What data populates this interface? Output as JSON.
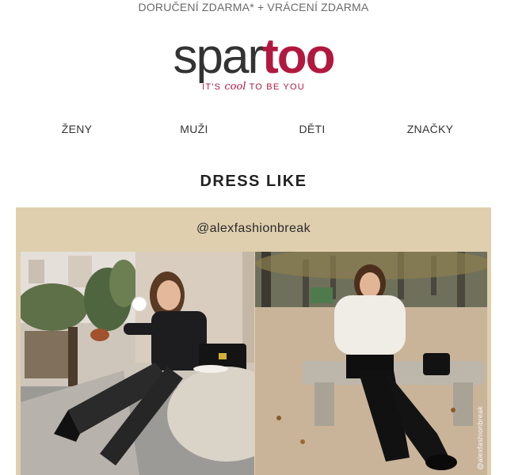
{
  "topbar": {
    "text": "DORUČENÍ ZDARMA* + VRÁCENÍ ZDARMA"
  },
  "logo": {
    "part1": "spar",
    "part2": "too",
    "tagline_pre": "IT'S",
    "tagline_cool": "cool",
    "tagline_post": "TO BE YOU"
  },
  "nav": {
    "items": [
      "ŽENY",
      "MUŽI",
      "DĚTI",
      "ZNAČKY"
    ]
  },
  "section": {
    "title": "DRESS LIKE"
  },
  "influencer": {
    "handle": "@alexfashionbreak",
    "watermark": "@alexfashionbreak"
  },
  "colors": {
    "brand": "#b2183f",
    "panel": "#dfcfae",
    "text": "#333333"
  }
}
